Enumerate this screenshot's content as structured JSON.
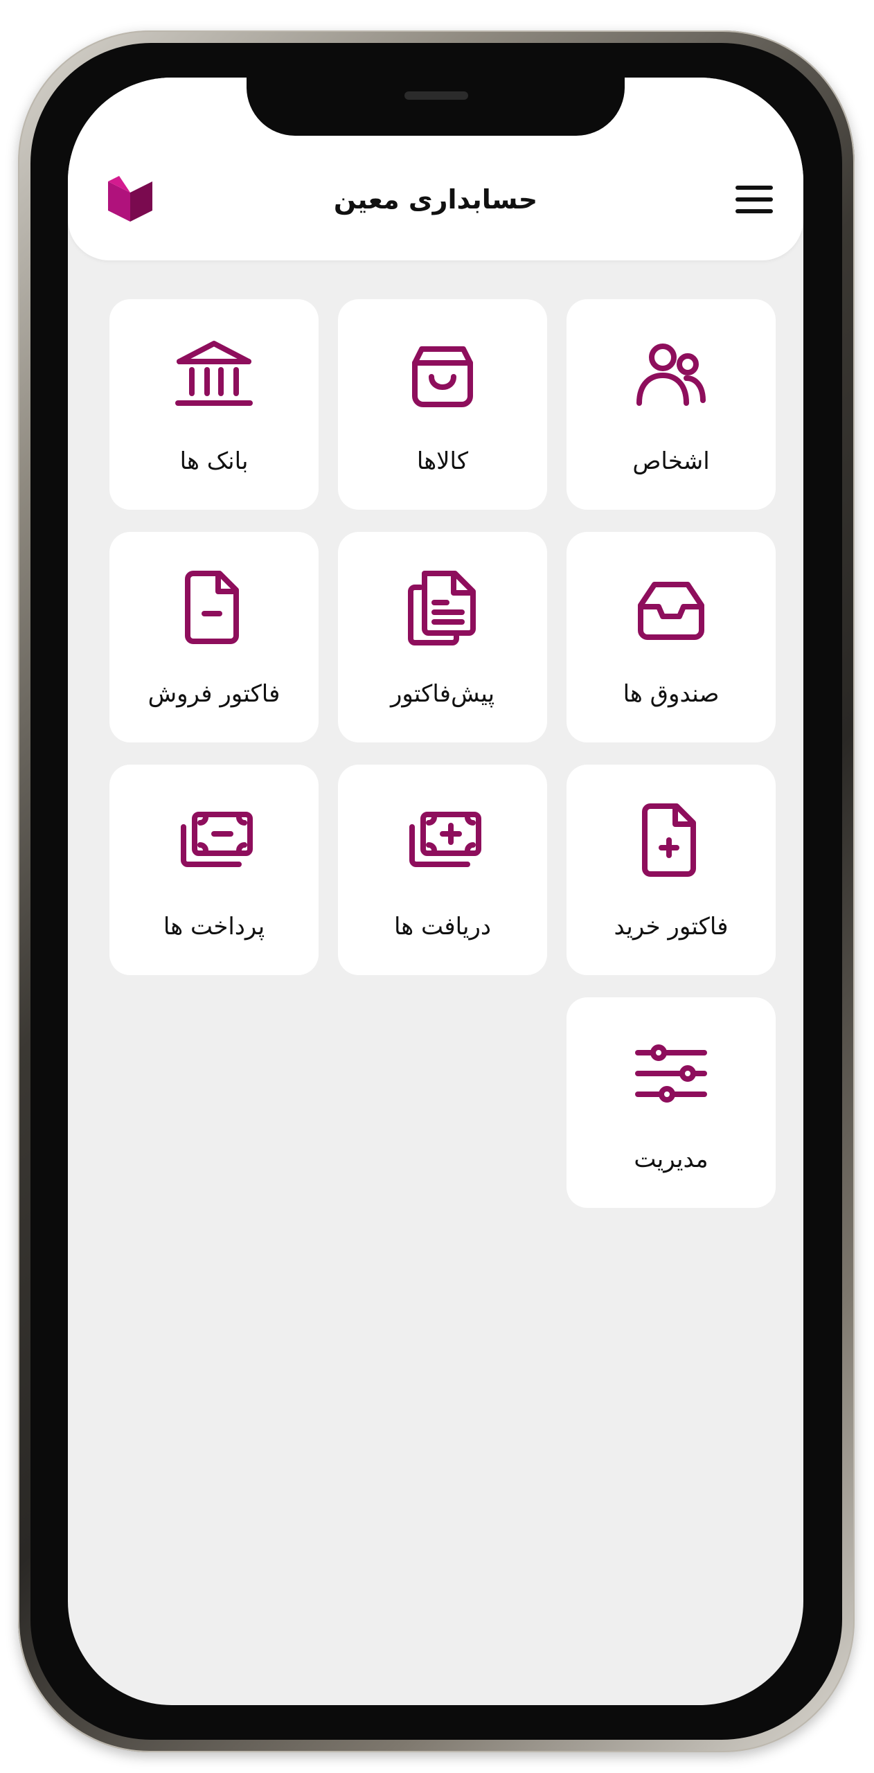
{
  "app": {
    "title": "حسابداری معین"
  },
  "colors": {
    "accent": "#8e0e5c",
    "background": "#efefef",
    "tile": "#ffffff"
  },
  "tiles": [
    {
      "label": "اشخاص",
      "icon": "users-icon"
    },
    {
      "label": "کالاها",
      "icon": "shopping-bag-icon"
    },
    {
      "label": "بانک ها",
      "icon": "bank-icon"
    },
    {
      "label": "صندوق ها",
      "icon": "inbox-icon"
    },
    {
      "label": "پیش‌فاکتور",
      "icon": "documents-icon"
    },
    {
      "label": "فاکتور فروش",
      "icon": "file-minus-icon"
    },
    {
      "label": "فاکتور خرید",
      "icon": "file-plus-icon"
    },
    {
      "label": "دریافت ها",
      "icon": "cash-plus-icon"
    },
    {
      "label": "پرداخت ها",
      "icon": "cash-minus-icon"
    },
    {
      "label": "مدیریت",
      "icon": "sliders-icon"
    }
  ]
}
